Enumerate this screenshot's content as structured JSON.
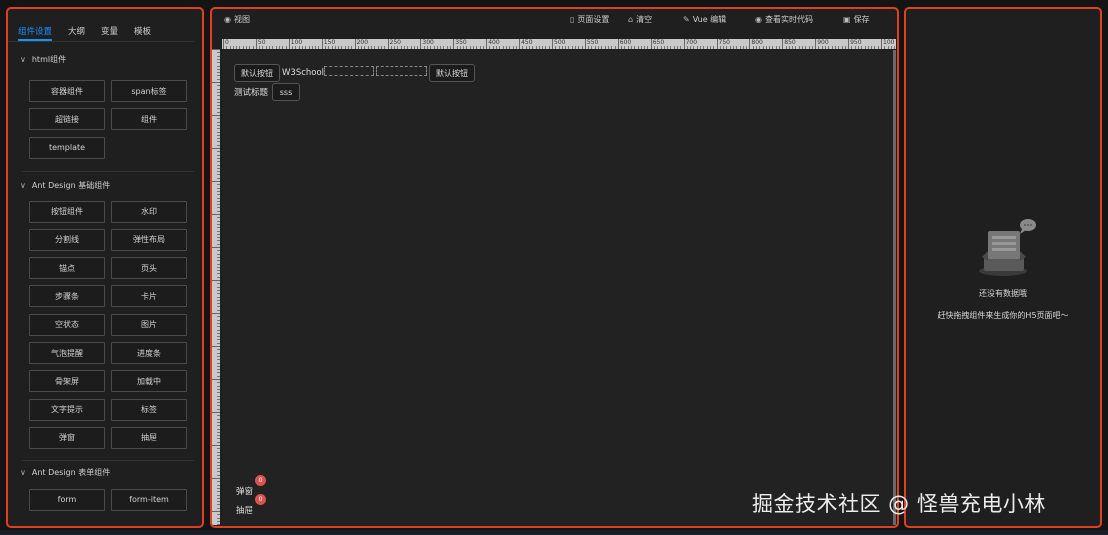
{
  "left_panel": {
    "tabs": [
      "组件设置",
      "大纲",
      "变量",
      "模板"
    ],
    "active_tab": 0,
    "sections": [
      {
        "title": "html组件",
        "items": [
          "容器组件",
          "span标签",
          "超链接",
          "组件",
          "template"
        ]
      },
      {
        "title": "Ant Design 基础组件",
        "items": [
          "按钮组件",
          "水印",
          "分割线",
          "弹性布局",
          "锚点",
          "页头",
          "步骤条",
          "卡片",
          "空状态",
          "图片",
          "气泡提醒",
          "进度条",
          "骨架屏",
          "加载中",
          "文字提示",
          "标签",
          "弹窗",
          "抽屉"
        ]
      },
      {
        "title": "Ant Design 表单组件",
        "items": [
          "form",
          "form-item"
        ]
      }
    ]
  },
  "toolbar": {
    "view_label": "视图",
    "page_settings_label": "页面设置",
    "clear_label": "清空",
    "vue_edit_label": "Vue 编辑",
    "live_code_label": "查看实时代码",
    "save_label": "保存"
  },
  "ruler": {
    "labels": [
      "0",
      "50",
      "100",
      "150",
      "200",
      "250",
      "300",
      "350",
      "400",
      "450",
      "500",
      "550",
      "600",
      "650",
      "700",
      "750",
      "800",
      "850",
      "900",
      "950",
      "100"
    ]
  },
  "canvas": {
    "button1": "默认按钮",
    "w3_text": "W3School",
    "button2": "默认按钮",
    "test_title": "测试标题",
    "sss_button": "sss",
    "modal_label": "弹窗",
    "drawer_label": "抽屉",
    "badge_count": "0"
  },
  "right_panel": {
    "empty_title": "还没有数据哦",
    "empty_hint": "赶快拖拽组件来生成你的H5页面吧～"
  },
  "watermark": "掘金技术社区 @ 怪兽充电小林",
  "colors": {
    "accent": "#1890ff",
    "frame": "#e0401f",
    "badge": "#d9534f",
    "background": "#1f1f1f"
  },
  "icons": {
    "view": "eye-icon",
    "page_settings": "document-icon",
    "clear": "trash-icon",
    "vue_edit": "edit-icon",
    "live_code": "eye-icon",
    "save": "save-icon",
    "section_toggle": "chevron-down-icon",
    "empty_state": "empty-box-icon"
  }
}
